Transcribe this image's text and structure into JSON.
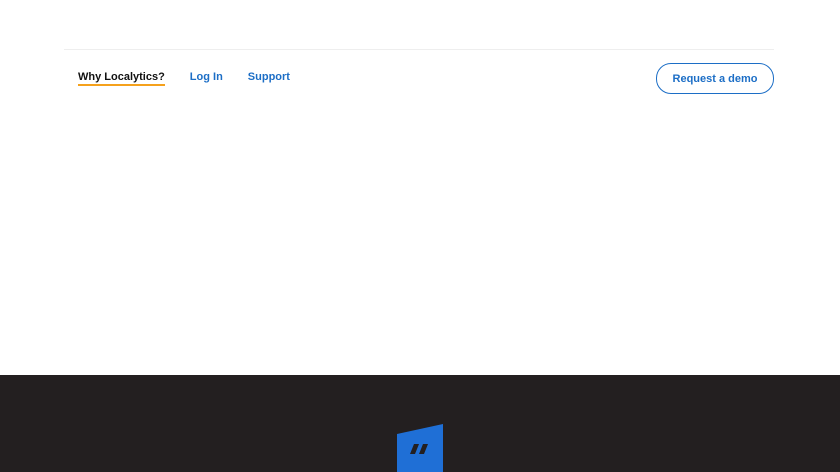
{
  "nav": {
    "links": [
      {
        "label": "Why Localytics?",
        "active": true
      },
      {
        "label": "Log In",
        "active": false
      },
      {
        "label": "Support",
        "active": false
      }
    ],
    "cta_label": "Request a demo"
  },
  "colors": {
    "accent": "#1c6ec6",
    "underline": "#f5a11c",
    "dark_band": "#231f20",
    "badge": "#1f6fd6"
  },
  "footer_band": {
    "icon": "quote-icon"
  }
}
